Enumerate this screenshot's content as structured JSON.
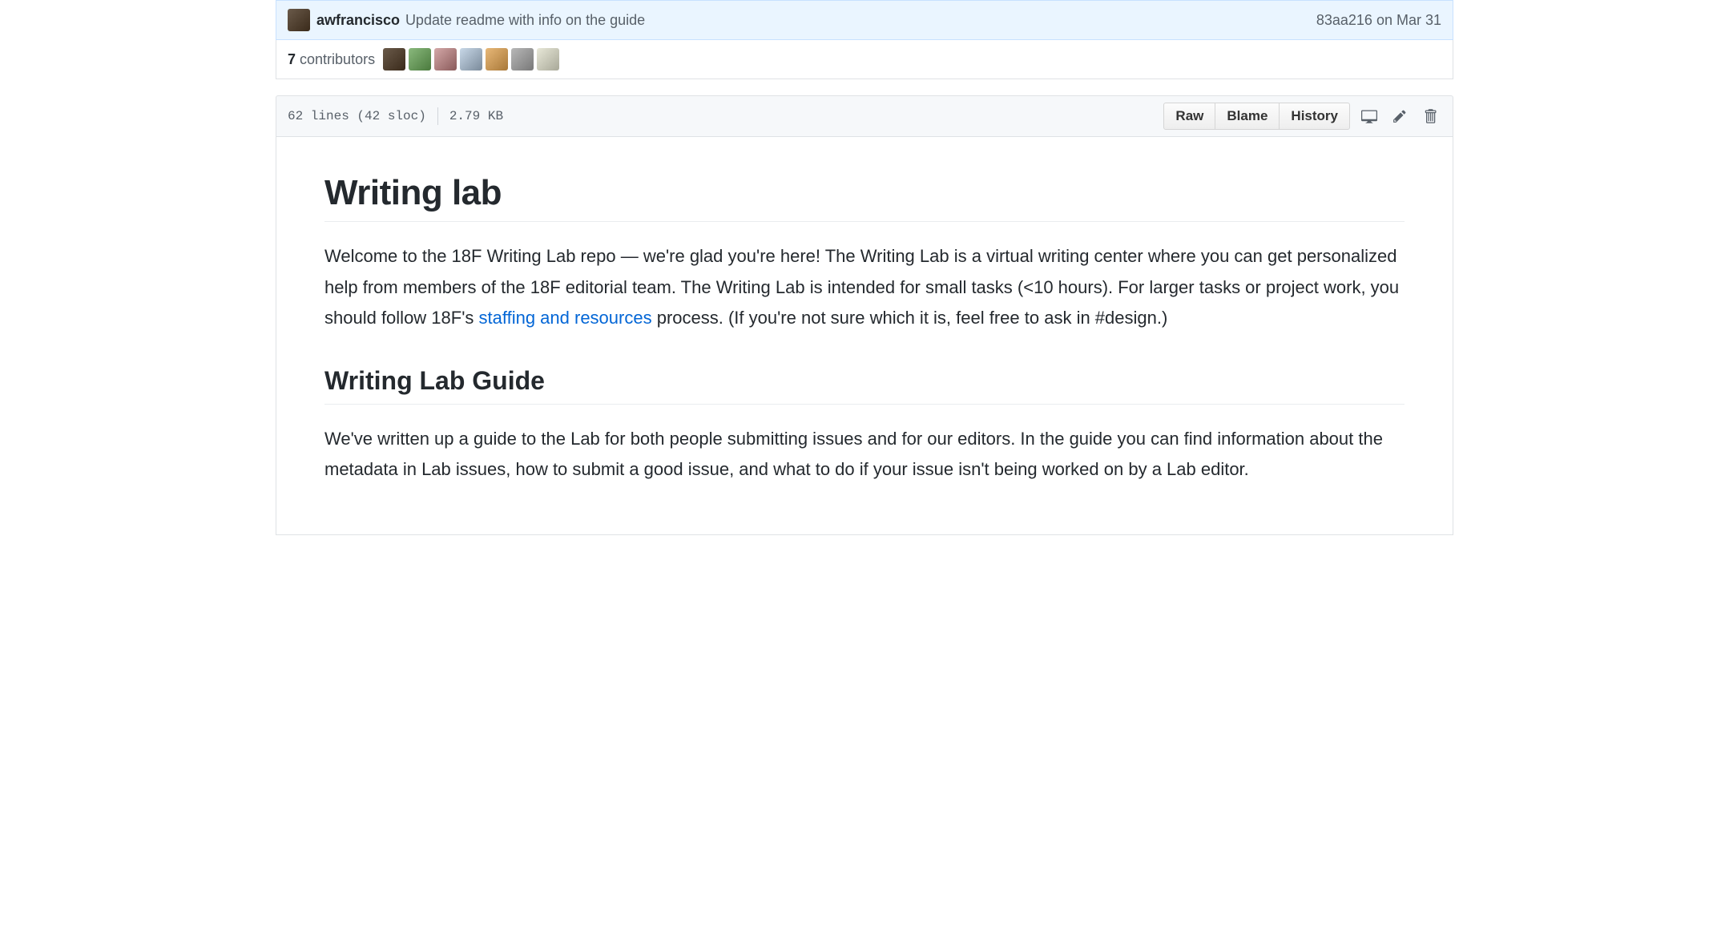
{
  "commit": {
    "author": "awfrancisco",
    "message": "Update readme with info on the guide",
    "sha": "83aa216",
    "date": "on Mar 31"
  },
  "contributors": {
    "count": "7",
    "label": "contributors"
  },
  "file": {
    "lines": "62 lines (42 sloc)",
    "size": "2.79 KB"
  },
  "actions": {
    "raw": "Raw",
    "blame": "Blame",
    "history": "History"
  },
  "readme": {
    "h1": "Writing lab",
    "p1_pre": "Welcome to the 18F Writing Lab repo — we're glad you're here! The Writing Lab is a virtual writing center where you can get personalized help from members of the 18F editorial team. The Writing Lab is intended for small tasks (<10 hours). For larger tasks or project work, you should follow 18F's ",
    "p1_link": "staffing and resources",
    "p1_post": " process. (If you're not sure which it is, feel free to ask in #design.)",
    "h2": "Writing Lab Guide",
    "p2": "We've written up a guide to the Lab for both people submitting issues and for our editors. In the guide you can find information about the metadata in Lab issues, how to submit a good issue, and what to do if your issue isn't being worked on by a Lab editor."
  }
}
